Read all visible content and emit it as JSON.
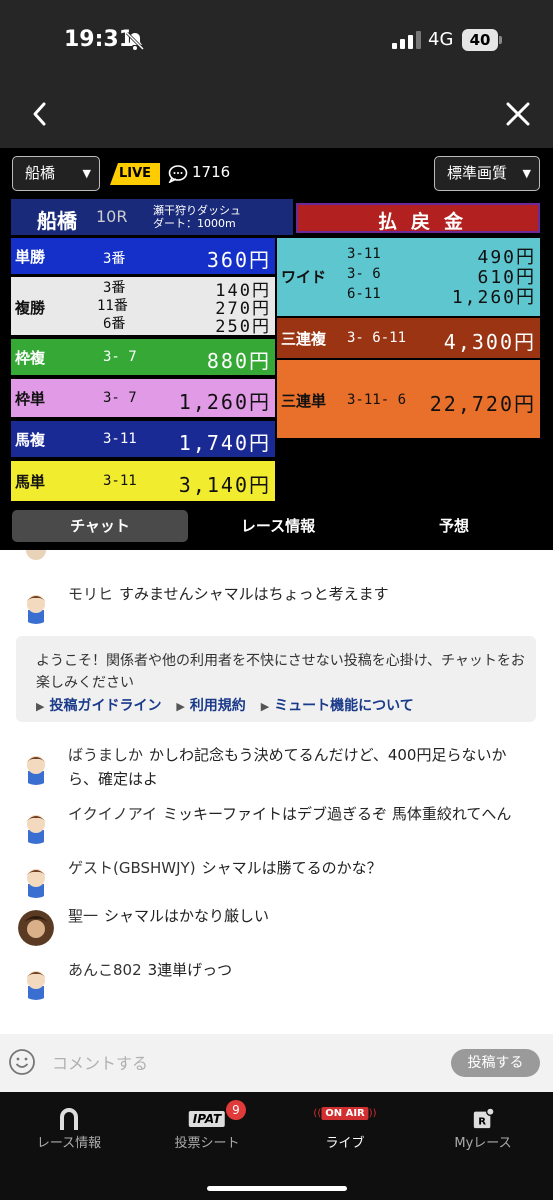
{
  "status_bar": {
    "time": "19:31",
    "network": "4G",
    "battery": "40"
  },
  "player": {
    "venue_select": "船橋",
    "live_label": "LIVE",
    "viewer_count": "1716",
    "quality_select": "標準画質"
  },
  "board": {
    "venue": "船橋",
    "race_number": "10R",
    "race_name_line1": "瀬干狩りダッシュ",
    "race_name_line2": "ダート：1000m",
    "header_right": "払戻金",
    "left_rows": [
      {
        "label": "単勝",
        "numbers": [
          "3番"
        ],
        "payouts": [
          "360円"
        ]
      },
      {
        "label": "複勝",
        "numbers": [
          "3番",
          "11番",
          "6番"
        ],
        "payouts": [
          "140円",
          "270円",
          "250円"
        ]
      },
      {
        "label": "枠複",
        "numbers": [
          "3- 7"
        ],
        "payouts": [
          "880円"
        ]
      },
      {
        "label": "枠単",
        "numbers": [
          "3- 7"
        ],
        "payouts": [
          "1,260円"
        ]
      },
      {
        "label": "馬複",
        "numbers": [
          "3-11"
        ],
        "payouts": [
          "1,740円"
        ]
      },
      {
        "label": "馬単",
        "numbers": [
          "3-11"
        ],
        "payouts": [
          "3,140円"
        ]
      }
    ],
    "right_rows": [
      {
        "label": "ワイド",
        "numbers": [
          "3-11",
          "3- 6",
          "6-11"
        ],
        "payouts": [
          "490円",
          "610円",
          "1,260円"
        ]
      },
      {
        "label": "三連複",
        "numbers": [
          "3- 6-11"
        ],
        "payouts": [
          "4,300円"
        ]
      },
      {
        "label": "三連単",
        "numbers": [
          "3-11- 6"
        ],
        "payouts": [
          "22,720円"
        ]
      }
    ]
  },
  "tabs": [
    "チャット",
    "レース情報",
    "予想"
  ],
  "chat": {
    "messages": [
      {
        "user": "モリヒ",
        "text": "すみませんシャマルはちょっと考えます"
      },
      {
        "user": "ばうましか",
        "text": "かしわ記念もう決めてるんだけど、400円足らないから、確定はよ"
      },
      {
        "user": "イクイノアイ",
        "text": "ミッキーファイトはデブ過ぎるぞ 馬体重絞れてへん"
      },
      {
        "user": "ゲスト(GBSHWJY)",
        "text": "シャマルは勝てるのかな？"
      },
      {
        "user": "聖一",
        "text": "シャマルはかなり厳しい"
      },
      {
        "user": "あんこ802",
        "text": "3連単げっつ"
      }
    ],
    "welcome": {
      "text": "ようこそ！関係者や他の利用者を不快にさせない投稿を心掛け、チャットをお楽しみください",
      "links": [
        "投稿ガイドライン",
        "利用規約",
        "ミュート機能について"
      ]
    }
  },
  "comment_bar": {
    "placeholder": "コメントする",
    "post_label": "投稿する"
  },
  "bottom_nav": {
    "items": [
      "レース情報",
      "投票シート",
      "ライブ",
      "Myレース"
    ],
    "ipat_label": "IPAT",
    "ipat_badge": "9",
    "onair_label": "ON AIR"
  }
}
